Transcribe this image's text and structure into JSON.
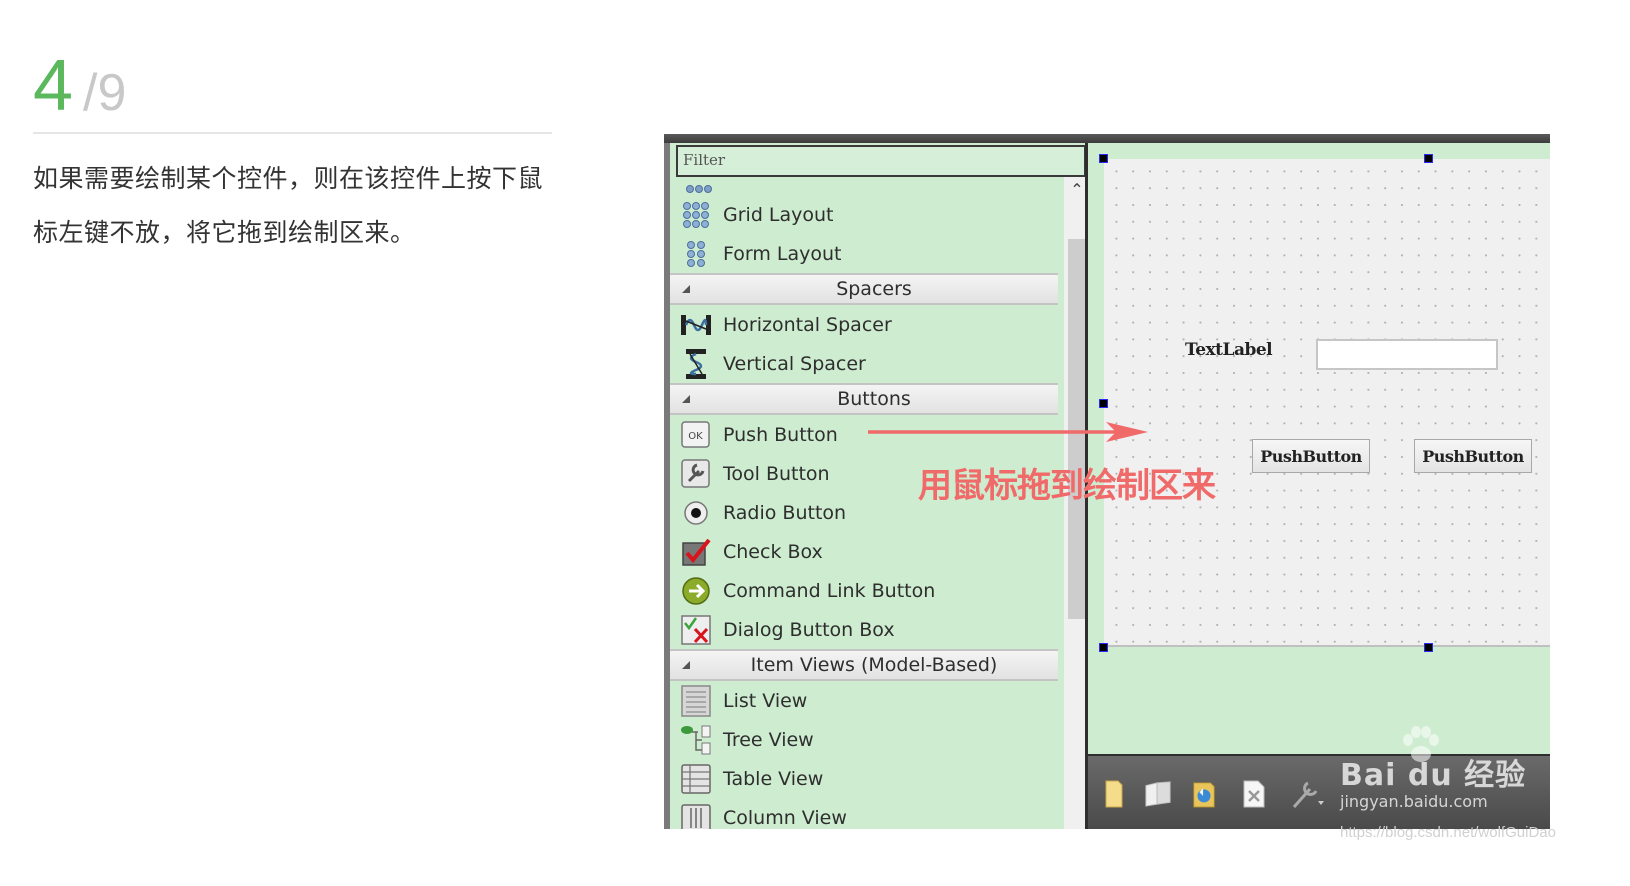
{
  "step": {
    "current": "4",
    "total": "/9"
  },
  "instruction": "如果需要绘制某个控件，则在该控件上按下鼠标左键不放，将它拖到绘制区来。",
  "widget_box": {
    "filter_placeholder": "Filter",
    "groups": [
      {
        "category": null,
        "items": [
          {
            "label": "Grid Layout",
            "icon": "grid-layout-icon"
          },
          {
            "label": "Form Layout",
            "icon": "form-layout-icon"
          }
        ]
      },
      {
        "category": "Spacers",
        "items": [
          {
            "label": "Horizontal Spacer",
            "icon": "horizontal-spacer-icon"
          },
          {
            "label": "Vertical Spacer",
            "icon": "vertical-spacer-icon"
          }
        ]
      },
      {
        "category": "Buttons",
        "items": [
          {
            "label": "Push Button",
            "icon": "push-button-icon"
          },
          {
            "label": "Tool Button",
            "icon": "tool-button-icon"
          },
          {
            "label": "Radio Button",
            "icon": "radio-button-icon"
          },
          {
            "label": "Check Box",
            "icon": "check-box-icon"
          },
          {
            "label": "Command Link Button",
            "icon": "command-link-icon"
          },
          {
            "label": "Dialog Button Box",
            "icon": "dialog-button-box-icon"
          }
        ]
      },
      {
        "category": "Item Views (Model-Based)",
        "items": [
          {
            "label": "List View",
            "icon": "list-view-icon"
          },
          {
            "label": "Tree View",
            "icon": "tree-view-icon"
          },
          {
            "label": "Table View",
            "icon": "table-view-icon"
          },
          {
            "label": "Column View",
            "icon": "column-view-icon"
          }
        ]
      }
    ]
  },
  "form": {
    "text_label": "TextLabel",
    "line_edit_value": "",
    "push_button_1": "PushButton",
    "push_button_2": "PushButton"
  },
  "toolbar": {
    "icons": [
      "new-file-icon",
      "copy-icon",
      "refresh-icon",
      "delete-file-icon",
      "wrench-icon"
    ]
  },
  "annotation": {
    "text": "用鼠标拖到绘制区来",
    "color": "#f06a6a"
  },
  "watermark": {
    "logo": "Bai du 经验",
    "url": "jingyan.baidu.com"
  },
  "credit": "https://blog.csdn.net/wolfGuiDao",
  "colors": {
    "accent_green": "#5cb85c",
    "panel_green": "#ceecd0"
  }
}
